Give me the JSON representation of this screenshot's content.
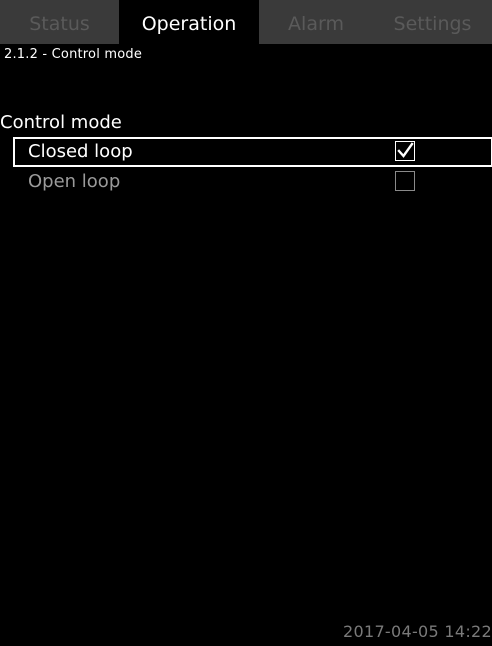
{
  "tabs": [
    {
      "label": "Status",
      "active": false
    },
    {
      "label": "Operation",
      "active": true
    },
    {
      "label": "Alarm",
      "active": false
    },
    {
      "label": "Settings",
      "active": false
    }
  ],
  "breadcrumb": "2.1.2 - Control mode",
  "section": {
    "heading": "Control mode",
    "options": [
      {
        "label": "Closed loop",
        "checked": true,
        "selected": true
      },
      {
        "label": "Open loop",
        "checked": false,
        "selected": false
      }
    ]
  },
  "footer": {
    "timestamp": "2017-04-05 14:22"
  },
  "colors": {
    "background": "#000000",
    "tabbar": "#3a3a3a",
    "inactive_tab_text": "#5a5a5a",
    "timestamp": "#7a7a7a"
  }
}
